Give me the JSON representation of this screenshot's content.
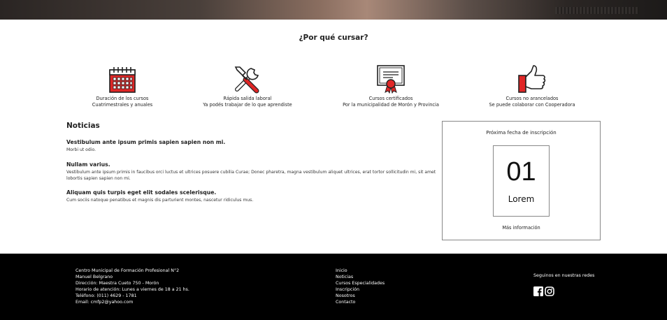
{
  "why": {
    "title": "¿Por qué cursar?",
    "features": [
      {
        "icon": "calendar-icon",
        "line1": "Duración de los cursos",
        "line2": "Cuatrimestrales y anuales"
      },
      {
        "icon": "tools-icon",
        "line1": "Rápida salida laboral",
        "line2": "Ya podés trabajar de lo que aprendiste"
      },
      {
        "icon": "certificate-icon",
        "line1": "Cursos certificados",
        "line2": "Por la municipalidad de Morón y Provincia"
      },
      {
        "icon": "thumbs-up-icon",
        "line1": "Cursos no arancelados",
        "line2": "Se puede colaborar con Cooperadora"
      }
    ]
  },
  "news": {
    "title": "Noticias",
    "items": [
      {
        "title": "Vestibulum ante ipsum primis sapien sapien non mi.",
        "body": "Morbi ut odio."
      },
      {
        "title": "Nullam varius.",
        "body": "Vestibulum ante ipsum primis in faucibus orci luctus et ultrices posuere cubilia Curae; Donec pharetra, magna vestibulum aliquet ultrices, erat tortor sollicitudin mi, sit amet lobortis sapien sapien non mi."
      },
      {
        "title": "Aliquam quis turpis eget elit sodales scelerisque.",
        "body": "Cum sociis natoque penatibus et magnis dis parturient montes, nascetur ridiculus mus."
      }
    ]
  },
  "enrollment": {
    "title": "Próxima fecha de inscripción",
    "day": "01",
    "month": "Lorem",
    "more": "Más información"
  },
  "footer": {
    "org": "Centro Municipal de Formación Profesional N°2",
    "name": "Manuel Belgrano",
    "address_label": "Dirección:",
    "address": "Maestra Cueto 750 - Morón",
    "hours_label": "Horario de atención:",
    "hours": "Lunes a viernes de 18 a 21 hs.",
    "phone_label": "Teléfono:",
    "phone": "(011) 4629 - 1781",
    "email_label": "Email:",
    "email": "cmfp2@yahoo.com",
    "nav": [
      "Inicio",
      "Noticias",
      "Cursos Especialidades",
      "Inscripción",
      "Nosotros",
      "Contacto"
    ],
    "social_title": "Seguinos en nuestras redes",
    "social_icons": [
      "facebook-icon",
      "instagram-icon"
    ]
  },
  "colors": {
    "accent": "#e02626",
    "footer_bg": "#000000"
  }
}
